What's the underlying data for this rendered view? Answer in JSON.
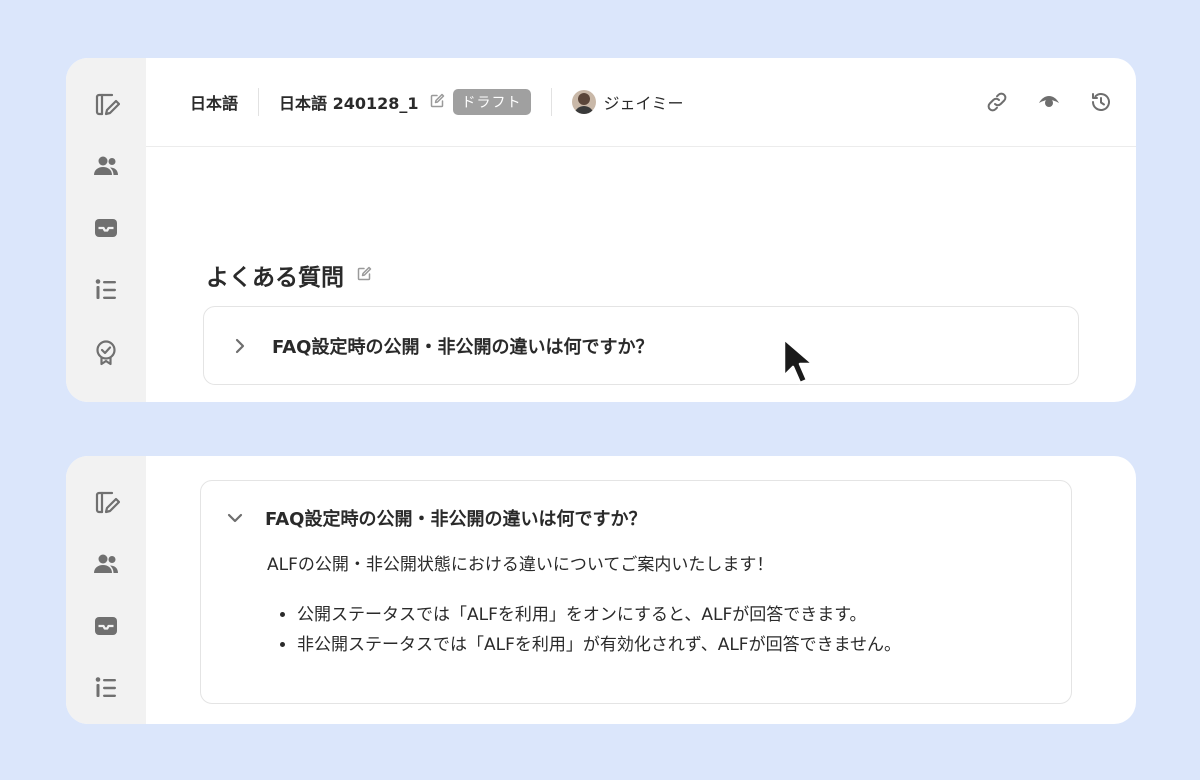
{
  "header": {
    "language": "日本語",
    "document_name": "日本語 240128_1",
    "status_badge": "ドラフト",
    "user_name": "ジェイミー"
  },
  "sidebar": {
    "items": [
      {
        "icon": "edit-note-icon"
      },
      {
        "icon": "users-icon"
      },
      {
        "icon": "inbox-icon"
      },
      {
        "icon": "list-icon"
      },
      {
        "icon": "badge-check-icon"
      }
    ]
  },
  "actions": [
    {
      "icon": "link-icon"
    },
    {
      "icon": "eye-icon"
    },
    {
      "icon": "history-icon"
    }
  ],
  "section": {
    "title": "よくある質問"
  },
  "faq": {
    "question": "FAQ設定時の公開・非公開の違いは何ですか？",
    "answer_intro": "ALFの公開・非公開状態における違いについてご案内いたします！",
    "answer_points": [
      "公開ステータスでは「ALFを利用」をオンにすると、ALFが回答できます。",
      "非公開ステータスでは「ALFを利用」が有効化されず、ALFが回答できません。"
    ]
  },
  "colors": {
    "background": "#dbe6fb",
    "sidebar": "#f2f2f2",
    "badge": "#a0a0a0",
    "icon": "#6e6e6e"
  }
}
